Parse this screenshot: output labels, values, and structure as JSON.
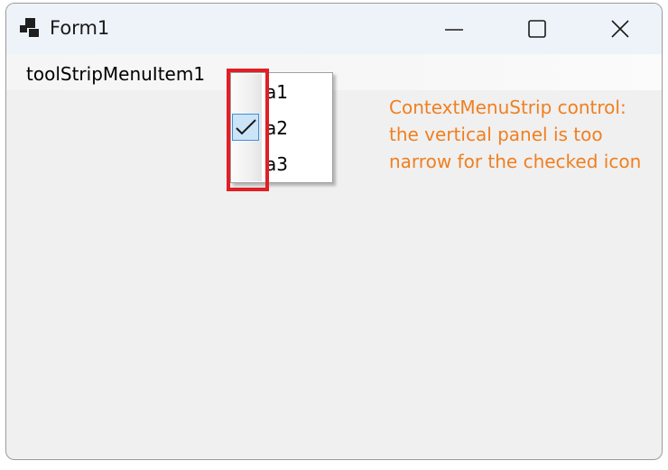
{
  "window": {
    "title": "Form1",
    "icon": "app-window-icon",
    "controls": {
      "minimize": "minimize-icon",
      "maximize": "maximize-icon",
      "close": "close-icon"
    }
  },
  "menubar": {
    "items": [
      {
        "label": "toolStripMenuItem1"
      }
    ]
  },
  "dropdown": {
    "items": [
      {
        "label": "a1",
        "checked": false
      },
      {
        "label": "a2",
        "checked": true
      },
      {
        "label": "a3",
        "checked": false
      }
    ]
  },
  "annotation": {
    "text": "ContextMenuStrip control: the vertical panel is too narrow for the checked icon",
    "color": "#f07f1f"
  },
  "highlight_color": "#e01f26"
}
